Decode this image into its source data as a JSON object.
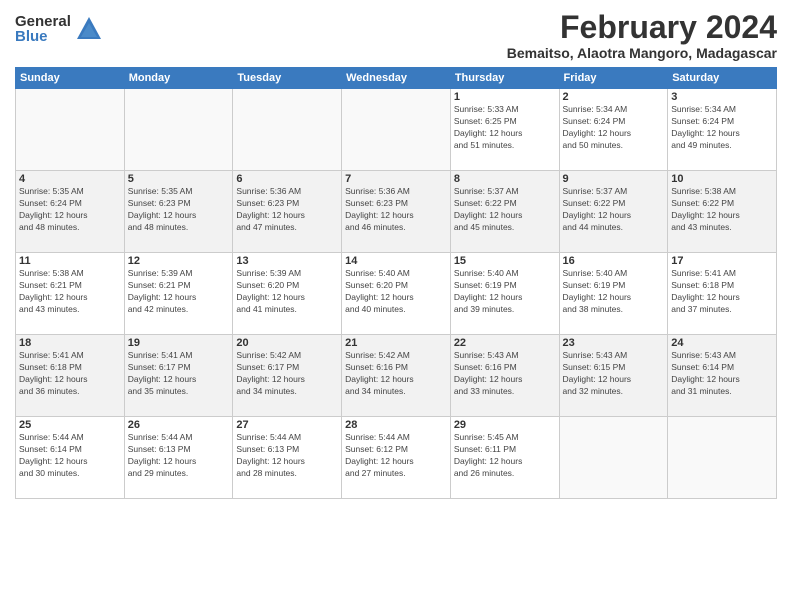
{
  "logo": {
    "general": "General",
    "blue": "Blue"
  },
  "title": "February 2024",
  "subtitle": "Bemaitso, Alaotra Mangoro, Madagascar",
  "days_of_week": [
    "Sunday",
    "Monday",
    "Tuesday",
    "Wednesday",
    "Thursday",
    "Friday",
    "Saturday"
  ],
  "weeks": [
    [
      {
        "day": "",
        "info": ""
      },
      {
        "day": "",
        "info": ""
      },
      {
        "day": "",
        "info": ""
      },
      {
        "day": "",
        "info": ""
      },
      {
        "day": "1",
        "info": "Sunrise: 5:33 AM\nSunset: 6:25 PM\nDaylight: 12 hours\nand 51 minutes."
      },
      {
        "day": "2",
        "info": "Sunrise: 5:34 AM\nSunset: 6:24 PM\nDaylight: 12 hours\nand 50 minutes."
      },
      {
        "day": "3",
        "info": "Sunrise: 5:34 AM\nSunset: 6:24 PM\nDaylight: 12 hours\nand 49 minutes."
      }
    ],
    [
      {
        "day": "4",
        "info": "Sunrise: 5:35 AM\nSunset: 6:24 PM\nDaylight: 12 hours\nand 48 minutes."
      },
      {
        "day": "5",
        "info": "Sunrise: 5:35 AM\nSunset: 6:23 PM\nDaylight: 12 hours\nand 48 minutes."
      },
      {
        "day": "6",
        "info": "Sunrise: 5:36 AM\nSunset: 6:23 PM\nDaylight: 12 hours\nand 47 minutes."
      },
      {
        "day": "7",
        "info": "Sunrise: 5:36 AM\nSunset: 6:23 PM\nDaylight: 12 hours\nand 46 minutes."
      },
      {
        "day": "8",
        "info": "Sunrise: 5:37 AM\nSunset: 6:22 PM\nDaylight: 12 hours\nand 45 minutes."
      },
      {
        "day": "9",
        "info": "Sunrise: 5:37 AM\nSunset: 6:22 PM\nDaylight: 12 hours\nand 44 minutes."
      },
      {
        "day": "10",
        "info": "Sunrise: 5:38 AM\nSunset: 6:22 PM\nDaylight: 12 hours\nand 43 minutes."
      }
    ],
    [
      {
        "day": "11",
        "info": "Sunrise: 5:38 AM\nSunset: 6:21 PM\nDaylight: 12 hours\nand 43 minutes."
      },
      {
        "day": "12",
        "info": "Sunrise: 5:39 AM\nSunset: 6:21 PM\nDaylight: 12 hours\nand 42 minutes."
      },
      {
        "day": "13",
        "info": "Sunrise: 5:39 AM\nSunset: 6:20 PM\nDaylight: 12 hours\nand 41 minutes."
      },
      {
        "day": "14",
        "info": "Sunrise: 5:40 AM\nSunset: 6:20 PM\nDaylight: 12 hours\nand 40 minutes."
      },
      {
        "day": "15",
        "info": "Sunrise: 5:40 AM\nSunset: 6:19 PM\nDaylight: 12 hours\nand 39 minutes."
      },
      {
        "day": "16",
        "info": "Sunrise: 5:40 AM\nSunset: 6:19 PM\nDaylight: 12 hours\nand 38 minutes."
      },
      {
        "day": "17",
        "info": "Sunrise: 5:41 AM\nSunset: 6:18 PM\nDaylight: 12 hours\nand 37 minutes."
      }
    ],
    [
      {
        "day": "18",
        "info": "Sunrise: 5:41 AM\nSunset: 6:18 PM\nDaylight: 12 hours\nand 36 minutes."
      },
      {
        "day": "19",
        "info": "Sunrise: 5:41 AM\nSunset: 6:17 PM\nDaylight: 12 hours\nand 35 minutes."
      },
      {
        "day": "20",
        "info": "Sunrise: 5:42 AM\nSunset: 6:17 PM\nDaylight: 12 hours\nand 34 minutes."
      },
      {
        "day": "21",
        "info": "Sunrise: 5:42 AM\nSunset: 6:16 PM\nDaylight: 12 hours\nand 34 minutes."
      },
      {
        "day": "22",
        "info": "Sunrise: 5:43 AM\nSunset: 6:16 PM\nDaylight: 12 hours\nand 33 minutes."
      },
      {
        "day": "23",
        "info": "Sunrise: 5:43 AM\nSunset: 6:15 PM\nDaylight: 12 hours\nand 32 minutes."
      },
      {
        "day": "24",
        "info": "Sunrise: 5:43 AM\nSunset: 6:14 PM\nDaylight: 12 hours\nand 31 minutes."
      }
    ],
    [
      {
        "day": "25",
        "info": "Sunrise: 5:44 AM\nSunset: 6:14 PM\nDaylight: 12 hours\nand 30 minutes."
      },
      {
        "day": "26",
        "info": "Sunrise: 5:44 AM\nSunset: 6:13 PM\nDaylight: 12 hours\nand 29 minutes."
      },
      {
        "day": "27",
        "info": "Sunrise: 5:44 AM\nSunset: 6:13 PM\nDaylight: 12 hours\nand 28 minutes."
      },
      {
        "day": "28",
        "info": "Sunrise: 5:44 AM\nSunset: 6:12 PM\nDaylight: 12 hours\nand 27 minutes."
      },
      {
        "day": "29",
        "info": "Sunrise: 5:45 AM\nSunset: 6:11 PM\nDaylight: 12 hours\nand 26 minutes."
      },
      {
        "day": "",
        "info": ""
      },
      {
        "day": "",
        "info": ""
      }
    ]
  ]
}
